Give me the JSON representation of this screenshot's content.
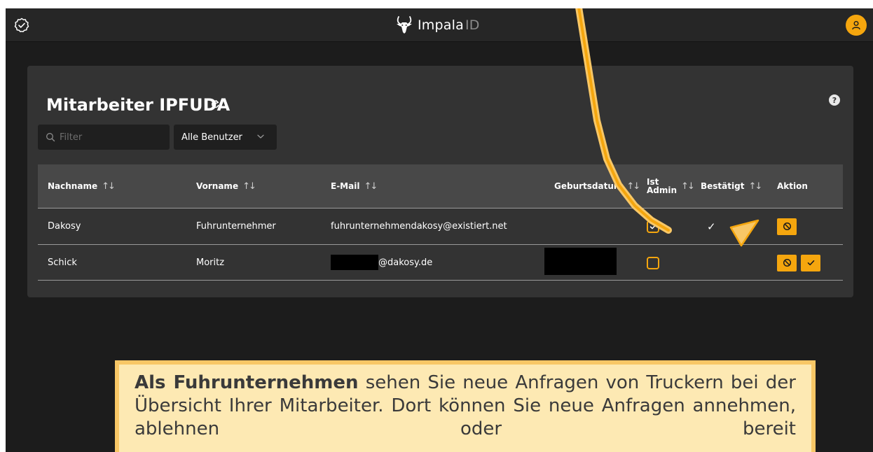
{
  "app": {
    "brand_name": "Impala",
    "brand_suffix": "ID"
  },
  "page": {
    "title": "Mitarbeiter IPFUDA",
    "help_label": "?"
  },
  "filter": {
    "placeholder": "Filter",
    "select_value": "Alle Benutzer"
  },
  "table": {
    "headers": {
      "lastname": "Nachname",
      "firstname": "Vorname",
      "email": "E-Mail",
      "birthdate": "Geburtsdatum",
      "admin_line1": "Ist",
      "admin_line2": "Admin",
      "confirmed": "Bestätigt",
      "action": "Aktion"
    },
    "sort_glyph": "↑↓",
    "rows": [
      {
        "lastname": "Dakosy",
        "firstname": "Fuhrunternehmer",
        "email": "fuhrunternehmendakosy@existiert.net",
        "birthdate": "",
        "is_admin": true,
        "confirmed": true,
        "confirmed_mark": "✓"
      },
      {
        "lastname": "Schick",
        "firstname": "Moritz",
        "email": "@dakosy.de",
        "birthdate": "",
        "is_admin": false,
        "confirmed": false,
        "confirmed_mark": ""
      }
    ]
  },
  "callout": {
    "bold": "Als Fuhrunternehmen",
    "text": " sehen Sie neue Anfragen von Truckern bei der Übersicht Ihrer Mitarbeiter. Dort können Sie neue Anfragen annehmen, ablehnen oder bereit"
  },
  "colors": {
    "accent": "#f5a60e",
    "background": "#1c1c1c",
    "card": "#333333",
    "callout_bg": "#fde9b3",
    "callout_border": "#f8c766",
    "arrow": "#f8c766"
  }
}
